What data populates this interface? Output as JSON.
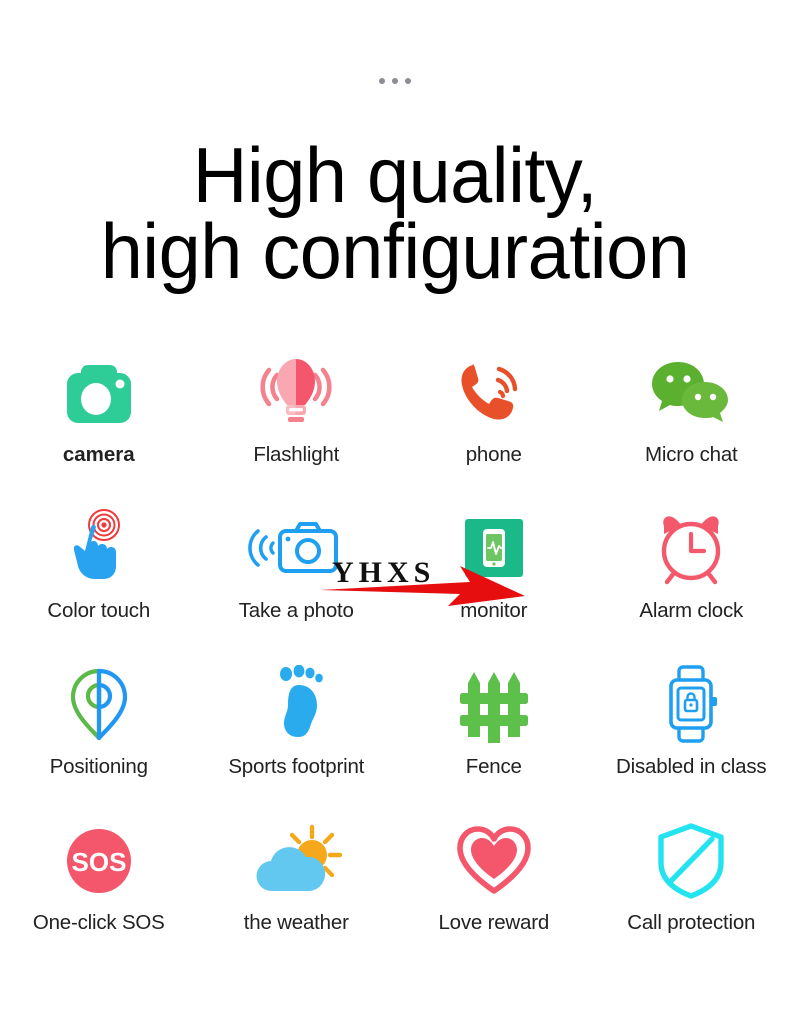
{
  "top_dots": {
    "count": 3,
    "color": "#8a8d91"
  },
  "headline": {
    "line1": "High quality,",
    "line2": "high configuration",
    "text": "High quality,\nhigh configuration",
    "color": "#000000"
  },
  "watermark": {
    "text": "YHXS",
    "arrow_color": "#e60e0e",
    "text_color": "#111111"
  },
  "grid": {
    "columns": 4,
    "rows": [
      {
        "cells": [
          {
            "label": "camera",
            "icon": "camera-icon",
            "color": "#2ecc96",
            "emphasis": true
          },
          {
            "label": "Flashlight",
            "icon": "flashlight-icon",
            "color": "#f58a95",
            "emphasis": false
          },
          {
            "label": "phone",
            "icon": "phone-call-icon",
            "color": "#e8502a",
            "emphasis": false
          },
          {
            "label": "Micro chat",
            "icon": "wechat-icon",
            "color": "#5cb030",
            "emphasis": false
          }
        ]
      },
      {
        "cells": [
          {
            "label": "Color touch",
            "icon": "touch-hand-icon",
            "color": "#29a3f0",
            "emphasis": false
          },
          {
            "label": "Take a photo",
            "icon": "take-photo-icon",
            "color": "#1e9ff2",
            "emphasis": false
          },
          {
            "label": "monitor",
            "icon": "monitor-icon",
            "color": "#1bb98a",
            "emphasis": false
          },
          {
            "label": "Alarm clock",
            "icon": "alarm-clock-icon",
            "color": "#f4596b",
            "emphasis": false
          }
        ]
      },
      {
        "cells": [
          {
            "label": "Positioning",
            "icon": "location-pin-icon",
            "color": "#5bba47",
            "emphasis": false
          },
          {
            "label": "Sports footprint",
            "icon": "footprint-icon",
            "color": "#29abee",
            "emphasis": false
          },
          {
            "label": "Fence",
            "icon": "fence-icon",
            "color": "#5cc04a",
            "emphasis": false
          },
          {
            "label": "Disabled in class",
            "icon": "watch-lock-icon",
            "color": "#1e9ff2",
            "emphasis": false
          }
        ]
      },
      {
        "cells": [
          {
            "label": "One-click SOS",
            "icon": "sos-icon",
            "color": "#f4566b",
            "emphasis": false
          },
          {
            "label": "the weather",
            "icon": "weather-cloud-sun-icon",
            "color": "#62c8ef",
            "emphasis": false
          },
          {
            "label": "Love reward",
            "icon": "heart-icon",
            "color": "#f4566b",
            "emphasis": false
          },
          {
            "label": "Call protection",
            "icon": "shield-block-icon",
            "color": "#24e3f0",
            "emphasis": false
          }
        ]
      }
    ]
  }
}
